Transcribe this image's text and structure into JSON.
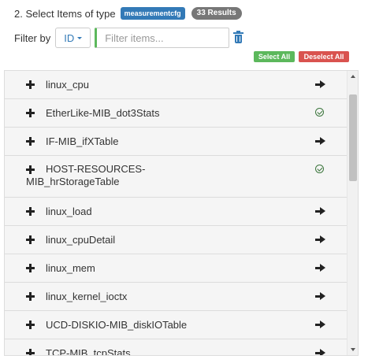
{
  "header": {
    "title": "2. Select Items of type",
    "type_badge": "measurementcfg",
    "results_badge": "33 Results"
  },
  "filter": {
    "label": "Filter by",
    "field_button": "ID",
    "placeholder": "Filter items...",
    "value": ""
  },
  "actions": {
    "select_all": "Select All",
    "deselect_all": "Deselect All"
  },
  "items": [
    {
      "label": "linux_cpu",
      "status": "arrow"
    },
    {
      "label": "EtherLike-MIB_dot3Stats",
      "status": "check"
    },
    {
      "label": "IF-MIB_ifXTable",
      "status": "arrow"
    },
    {
      "label": "HOST-RESOURCES-MIB_hrStorageTable",
      "status": "check"
    },
    {
      "label": "linux_load",
      "status": "arrow"
    },
    {
      "label": "linux_cpuDetail",
      "status": "arrow"
    },
    {
      "label": "linux_mem",
      "status": "arrow"
    },
    {
      "label": "linux_kernel_ioctx",
      "status": "arrow"
    },
    {
      "label": "UCD-DISKIO-MIB_diskIOTable",
      "status": "arrow"
    },
    {
      "label": "TCP-MIB_tcpStats",
      "status": "arrow"
    }
  ],
  "colors": {
    "type_badge": "#337ab7",
    "results_badge": "#777777",
    "select_all": "#5cb85c",
    "deselect_all": "#d9534f",
    "check": "#3c763d"
  },
  "icons": {
    "expand": "plus-icon",
    "add": "arrow-right-icon",
    "selected": "check-circle-icon",
    "clear": "trash-icon"
  }
}
